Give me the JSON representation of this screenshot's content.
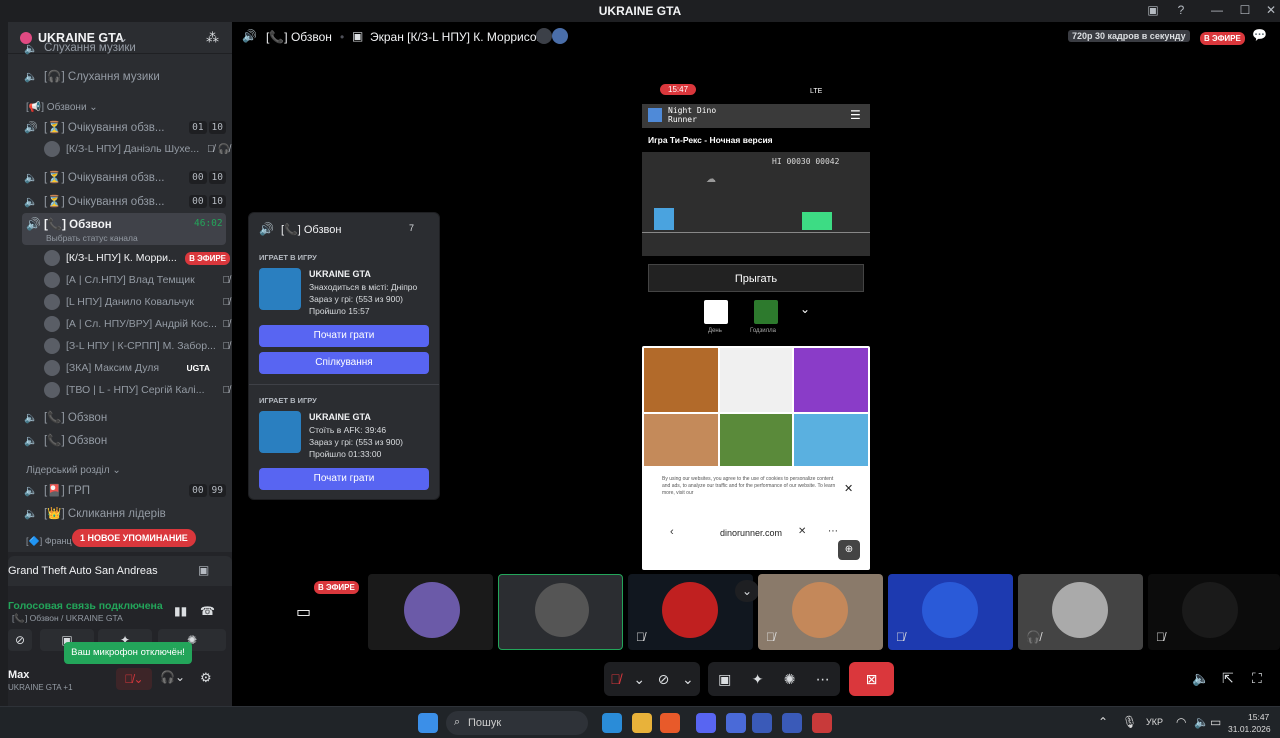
{
  "window": {
    "title": "UKRAINE GTA"
  },
  "server": {
    "name": "UKRAINE GTA"
  },
  "channels": {
    "cut_top": "Слухання музики",
    "music": "[🎧] Слухання музики",
    "cat_obzvony": "[📢] Обзвони",
    "waiting1": "[⏳] Очікування обзв...",
    "waiting1_count_a": "01",
    "waiting1_count_b": "10",
    "waiting1_user": "[К/З-L НПУ] Даніэль Шухе...",
    "waiting2": "[⏳] Очікування обзв...",
    "waiting2_count_a": "00",
    "waiting2_count_b": "10",
    "waiting3": "[⏳] Очікування обзв...",
    "waiting3_count_a": "00",
    "waiting3_count_b": "10",
    "active": "[📞] Обзвон",
    "active_time": "46:02",
    "active_status": "Выбрать статус канала",
    "members": [
      {
        "name": "[К/З-L НПУ] К. Морри...",
        "badge": "В ЭФИРЕ"
      },
      {
        "name": "[А | Сл.НПУ] Влад Темщик"
      },
      {
        "name": "[L НПУ] Данило Ковальчук"
      },
      {
        "name": "[А | Сл. НПУ/ВРУ] Андрій Кос..."
      },
      {
        "name": "[З-L НПУ | К-СРПП] М. Забор..."
      },
      {
        "name": "[ЗКА] Максим Дуля",
        "tag": "UGTA"
      },
      {
        "name": "[ТВО | L - НПУ] Сергій Калі..."
      }
    ],
    "obzvon2": "[📞] Обзвон",
    "obzvon3": "[📞] Обзвон",
    "cat_leader": "Лідерський розділ",
    "grp": "[🎴] ГРП",
    "grp_count_a": "00",
    "grp_count_b": "99",
    "leaders": "[👑] Скликання лідерів",
    "cut_bottom": "[🔷] Франц",
    "new_mention": "1 НОВОЕ УПОМИНАНИЕ"
  },
  "voice": {
    "game": "Grand Theft Auto San Andreas",
    "status": "Голосовая связь подключена",
    "channel": "[📞] Обзвон / UKRAINE GTA",
    "tooltip": "Ваш микрофон отключён!",
    "username": "Max",
    "user_sub": "UKRAINE GTA +1"
  },
  "topbar": {
    "channel": "[📞] Обзвон",
    "screen": "Экран [К/З-L НПУ] К. Моррисон",
    "quality": "720p 30 кадров в секунду",
    "live": "В ЭФИРЕ"
  },
  "popup": {
    "channel": "[📞] Обзвон",
    "count": "7",
    "section1": "ИГРАЕТ В ИГРУ",
    "game1_title": "UKRAINE GTA",
    "game1_l1": "Знаходиться в місті: Дніпро",
    "game1_l2": "Зараз у грі: (553 из 900)",
    "game1_l3": "Пройшло 15:57",
    "btn_play": "Почати грати",
    "btn_talk": "Спілкування",
    "section2": "ИГРАЕТ В ИГРУ",
    "game2_title": "UKRAINE GTA",
    "game2_l1": "Стоїть в AFK: 39:46",
    "game2_l2": "Зараз у грі: (553 из 900)",
    "game2_l3": "Пройшло 01:33:00",
    "btn_play2": "Почати грати"
  },
  "phone": {
    "time": "15:47",
    "net": "LTE",
    "site_logo": "Night Dino Runner",
    "page_title": "Игра Ти-Рекс - Ночная версия",
    "score": "HI 00030 00042",
    "jump_btn": "Прыгать",
    "mode_day": "День",
    "mode_god": "Годзилла",
    "cookie": "By using our websites, you agree to the use of cookies to personalize content and ads, to analyze our traffic and for the performance of our website. To learn more, visit our",
    "url": "dinorunner.com"
  },
  "tiles": {
    "live": "В ЭФИРЕ"
  },
  "taskbar": {
    "search": "Пошук",
    "lang": "УКР",
    "time": "15:47",
    "date": "31.01.2026"
  }
}
